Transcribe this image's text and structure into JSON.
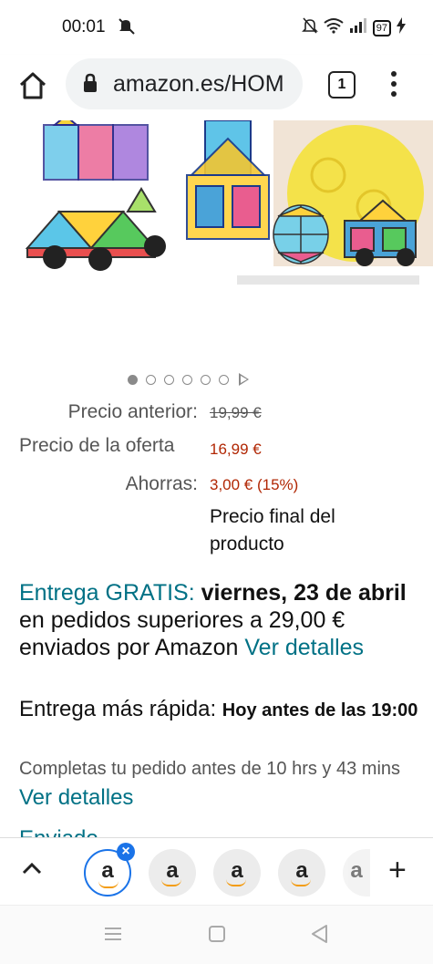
{
  "status_bar": {
    "time": "00:01",
    "battery": "97"
  },
  "browser": {
    "url": "amazon.es/HOM",
    "tab_count": "1"
  },
  "carousel": {
    "total": 6,
    "active_index": 0
  },
  "price": {
    "previous_label": "Precio anterior:",
    "previous_value": "19,99 €",
    "offer_label": "Precio de la oferta",
    "offer_value": "16,99 €",
    "savings_label": "Ahorras:",
    "savings_value": "3,00 € (15%)",
    "final_note": "Precio final del producto"
  },
  "delivery": {
    "free_label": "Entrega GRATIS:",
    "date": "viernes, 23 de abril",
    "condition": " en pedidos superiores a 29,00 € enviados por Amazon ",
    "details_link": "Ver detalles"
  },
  "fast_delivery": {
    "label": "Entrega más rápida: ",
    "when": "Hoy antes de las 19:00"
  },
  "countdown": {
    "text": "Completas tu pedido antes de 10 hrs y 43 mins ",
    "details_link": "Ver detalles"
  },
  "partial_heading": "Enviado",
  "tab_strip": {
    "tabs": [
      {
        "letter": "a",
        "active": true
      },
      {
        "letter": "a",
        "active": false
      },
      {
        "letter": "a",
        "active": false
      },
      {
        "letter": "a",
        "active": false
      },
      {
        "letter": "a",
        "active": false
      }
    ],
    "new_tab": "+"
  },
  "colors": {
    "link": "#007185",
    "price": "#b12704",
    "accent": "#1a73e8"
  },
  "icons": [
    "mute-icon",
    "wifi-icon",
    "signal-icon",
    "battery-icon",
    "home-icon",
    "lock-icon",
    "tabs-icon",
    "menu-icon",
    "chevron-up-icon",
    "close-icon",
    "plus-icon",
    "recents-icon",
    "home-nav-icon",
    "back-icon"
  ]
}
